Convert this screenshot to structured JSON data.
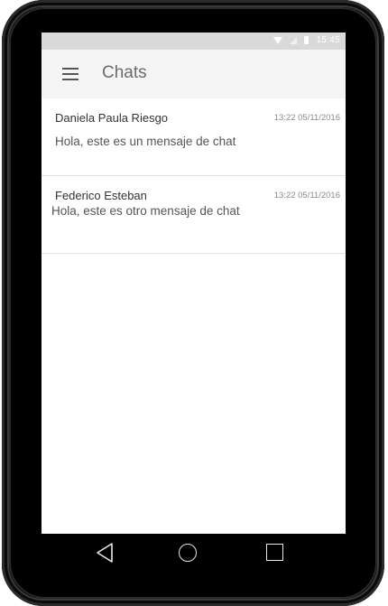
{
  "status_bar": {
    "time": "15:45"
  },
  "toolbar": {
    "title": "Chats",
    "menu_icon": "menu-icon"
  },
  "chats": [
    {
      "name": "Daniela Paula Riesgo",
      "timestamp": "13:22 05/11/2016",
      "message": "Hola, este es un mensaje de chat"
    },
    {
      "name": "Federico Esteban",
      "timestamp": "13:22 05/11/2016",
      "message": "Hola, este es otro mensaje de chat"
    }
  ],
  "nav_bar": {
    "icons": [
      "back-icon",
      "home-icon",
      "recents-icon"
    ]
  }
}
